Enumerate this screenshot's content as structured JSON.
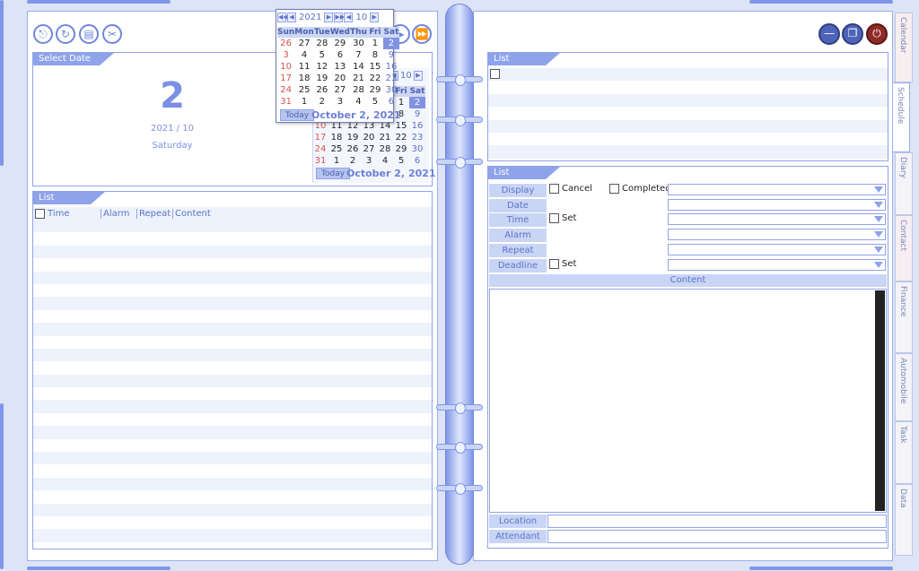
{
  "toolbar": {
    "left_icons": [
      "exit-icon",
      "undo-icon",
      "print-icon",
      "tools-icon"
    ],
    "right_icons": [
      "minimize-icon",
      "restore-icon",
      "power-icon"
    ]
  },
  "select_date": {
    "header": "Select Date",
    "day": "2",
    "year_month": "2021 / 10",
    "weekday": "Saturday"
  },
  "popup_calendar": {
    "year": "2021",
    "month": "10",
    "weekdays": [
      "Sun",
      "Mon",
      "Tue",
      "Wed",
      "Thu",
      "Fri",
      "Sat"
    ],
    "weeks": [
      [
        "26",
        "27",
        "28",
        "29",
        "30",
        "1",
        "2"
      ],
      [
        "3",
        "4",
        "5",
        "6",
        "7",
        "8",
        "9"
      ],
      [
        "10",
        "11",
        "12",
        "13",
        "14",
        "15",
        "16"
      ],
      [
        "17",
        "18",
        "19",
        "20",
        "21",
        "22",
        "23"
      ],
      [
        "24",
        "25",
        "26",
        "27",
        "28",
        "29",
        "30"
      ],
      [
        "31",
        "1",
        "2",
        "3",
        "4",
        "5",
        "6"
      ]
    ],
    "today_label": "Today",
    "footer_date": "October 2, 2021"
  },
  "back_calendar": {
    "month": "10",
    "weekdays": [
      "Fri",
      "Sat"
    ],
    "weeks": [
      [
        "1",
        "2"
      ],
      [
        "8",
        "9"
      ],
      [
        "10",
        "11",
        "12",
        "13",
        "14",
        "15",
        "16"
      ],
      [
        "17",
        "18",
        "19",
        "20",
        "21",
        "22",
        "23"
      ],
      [
        "24",
        "25",
        "26",
        "27",
        "28",
        "29",
        "30"
      ],
      [
        "31",
        "1",
        "2",
        "3",
        "4",
        "5",
        "6"
      ]
    ],
    "today_label": "Today",
    "footer_date": "October 2, 2021"
  },
  "left_list": {
    "header": "List",
    "columns": [
      "Time",
      "Alarm",
      "Repeat",
      "Content"
    ]
  },
  "right_list": {
    "header": "List"
  },
  "detail": {
    "header": "List",
    "labels": [
      "Display",
      "Date",
      "Time",
      "Alarm",
      "Repeat",
      "Deadline"
    ],
    "cancel_label": "Cancel",
    "completed_label": "Completed",
    "set_label": "Set",
    "deadline_set_label": "Set",
    "content_label": "Content",
    "location_label": "Location",
    "attendant_label": "Attendant"
  },
  "side_tabs": [
    "Calendar",
    "Schedule",
    "Diary",
    "Contact",
    "Finance",
    "Automobile",
    "Task",
    "Data"
  ]
}
